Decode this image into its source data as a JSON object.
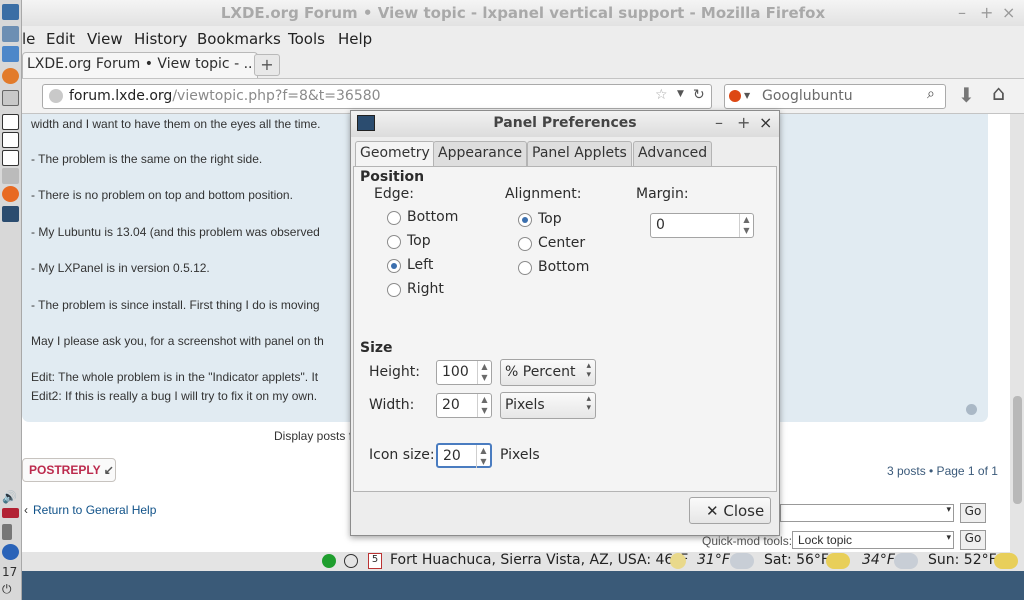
{
  "window": {
    "title": "LXDE.org Forum • View topic - lxpanel vertical support - Mozilla Firefox",
    "controls": [
      "–",
      "+",
      "×"
    ]
  },
  "menubar": [
    "le",
    "Edit",
    "View",
    "History",
    "Bookmarks",
    "Tools",
    "Help"
  ],
  "tab": {
    "label": "LXDE.org Forum • View topic - ...",
    "new_tab": "+"
  },
  "navbar": {
    "url_domain": "forum.lxde.org",
    "url_path": "/viewtopic.php?f=8&t=36580",
    "search_value": "Googlubuntu"
  },
  "post": {
    "lines": [
      "width and I want to have them on the eyes all the time.",
      "- The problem is the same on the right side.",
      "- There is no problem on top and bottom position.",
      "- My Lubuntu is 13.04 (and this problem was observed",
      "- My LXPanel is in version 0.5.12.",
      "- The problem is since install. First thing I do is moving",
      "May I please ask you, for a screenshot with panel on th",
      "Edit: The whole problem is in the \"Indicator applets\". It",
      "Edit2: If this is really a bug I will try to fix it on my own."
    ]
  },
  "page": {
    "display_posts": "Display posts fr",
    "postreply": "POSTREPLY",
    "posts_count": "3 posts • Page 1 of 1",
    "return_link": "Return to General Help",
    "quickmod_label": "Quick-mod tools:",
    "quickmod_value": "Lock topic",
    "go": "Go"
  },
  "taskbar": {
    "date_day": "5",
    "weather": "Fort Huachuca, Sierra Vista, AZ, USA: 46°F",
    "forecast1": "31°F",
    "forecast2": "Sat: 56°F",
    "forecast3": "34°F",
    "forecast4": "Sun: 52°F",
    "clock_hour": "17"
  },
  "dialog": {
    "title": "Panel Preferences",
    "tabs": [
      "Geometry",
      "Appearance",
      "Panel Applets",
      "Advanced"
    ],
    "position_heading": "Position",
    "edge_label": "Edge:",
    "edge_options": [
      "Bottom",
      "Top",
      "Left",
      "Right"
    ],
    "edge_selected": "Left",
    "alignment_label": "Alignment:",
    "alignment_options": [
      "Top",
      "Center",
      "Bottom"
    ],
    "alignment_selected": "Top",
    "margin_label": "Margin:",
    "margin_value": "0",
    "size_heading": "Size",
    "height_label": "Height:",
    "height_value": "100",
    "height_unit": "% Percent",
    "width_label": "Width:",
    "width_value": "20",
    "width_unit": "Pixels",
    "iconsize_label": "Icon size:",
    "iconsize_value": "20",
    "iconsize_unit": "Pixels",
    "close_label": "Close"
  },
  "colors": {
    "post_bg": "#e1ebf2",
    "link": "#105289",
    "postreply": "#bc2a4d",
    "radio_selected": "#3b6fae"
  }
}
